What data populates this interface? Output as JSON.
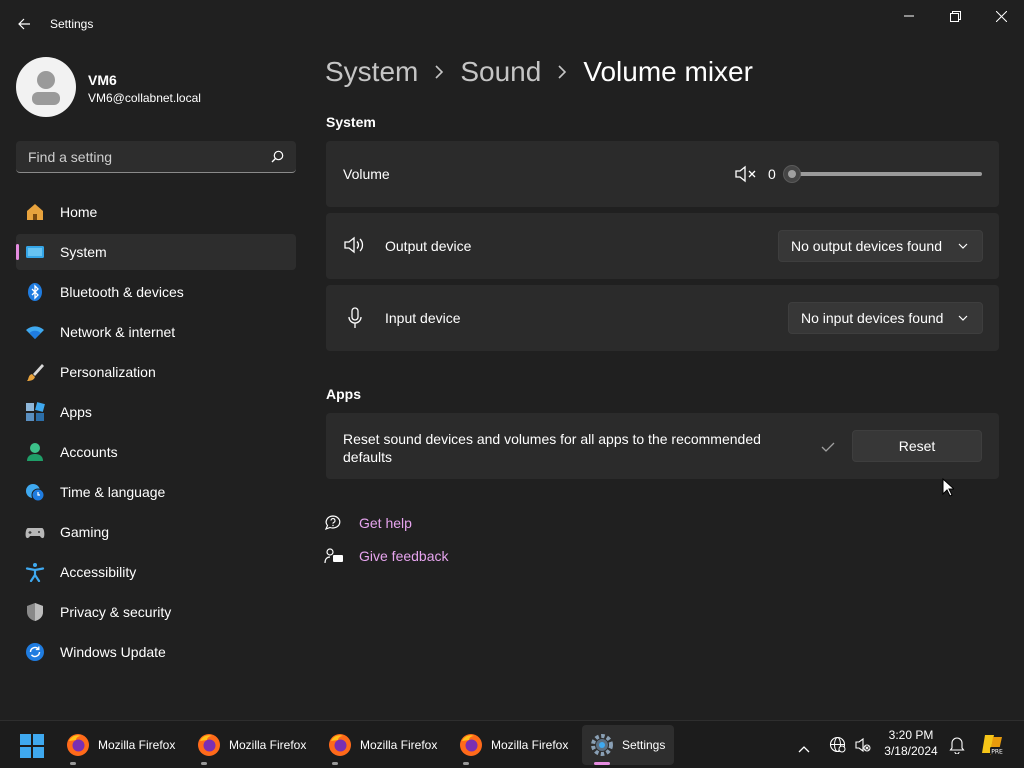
{
  "window": {
    "title": "Settings"
  },
  "user": {
    "name": "VM6",
    "email": "VM6@collabnet.local"
  },
  "search": {
    "placeholder": "Find a setting"
  },
  "sidebar": {
    "items": [
      {
        "label": "Home",
        "icon": "home-icon"
      },
      {
        "label": "System",
        "icon": "system-icon",
        "active": true
      },
      {
        "label": "Bluetooth & devices",
        "icon": "bluetooth-icon"
      },
      {
        "label": "Network & internet",
        "icon": "wifi-icon"
      },
      {
        "label": "Personalization",
        "icon": "brush-icon"
      },
      {
        "label": "Apps",
        "icon": "apps-icon"
      },
      {
        "label": "Accounts",
        "icon": "accounts-icon"
      },
      {
        "label": "Time & language",
        "icon": "clock-globe-icon"
      },
      {
        "label": "Gaming",
        "icon": "gamepad-icon"
      },
      {
        "label": "Accessibility",
        "icon": "accessibility-icon"
      },
      {
        "label": "Privacy & security",
        "icon": "shield-icon"
      },
      {
        "label": "Windows Update",
        "icon": "update-icon"
      }
    ]
  },
  "breadcrumb": {
    "level1": "System",
    "level2": "Sound",
    "current": "Volume mixer"
  },
  "system_section": {
    "title": "System",
    "volume": {
      "label": "Volume",
      "value": "0",
      "level_percent": 0,
      "muted": true
    },
    "output": {
      "label": "Output device",
      "value": "No output devices found"
    },
    "input": {
      "label": "Input device",
      "value": "No input devices found"
    }
  },
  "apps_section": {
    "title": "Apps",
    "reset_text": "Reset sound devices and volumes for all apps to the recommended defaults",
    "reset_button": "Reset"
  },
  "links": {
    "help": "Get help",
    "feedback": "Give feedback"
  },
  "taskbar": {
    "apps": [
      {
        "label": "Mozilla Firefox",
        "icon": "firefox-icon"
      },
      {
        "label": "Mozilla Firefox",
        "icon": "firefox-icon"
      },
      {
        "label": "Mozilla Firefox",
        "icon": "firefox-icon"
      },
      {
        "label": "Mozilla Firefox",
        "icon": "firefox-icon"
      },
      {
        "label": "Settings",
        "icon": "settings-gear-icon",
        "active": true
      }
    ],
    "time": "3:20 PM",
    "date": "3/18/2024"
  },
  "colors": {
    "accent": "#e58ce0",
    "link": "#e6a4ee",
    "card": "#2b2b2b",
    "background": "#202020"
  }
}
